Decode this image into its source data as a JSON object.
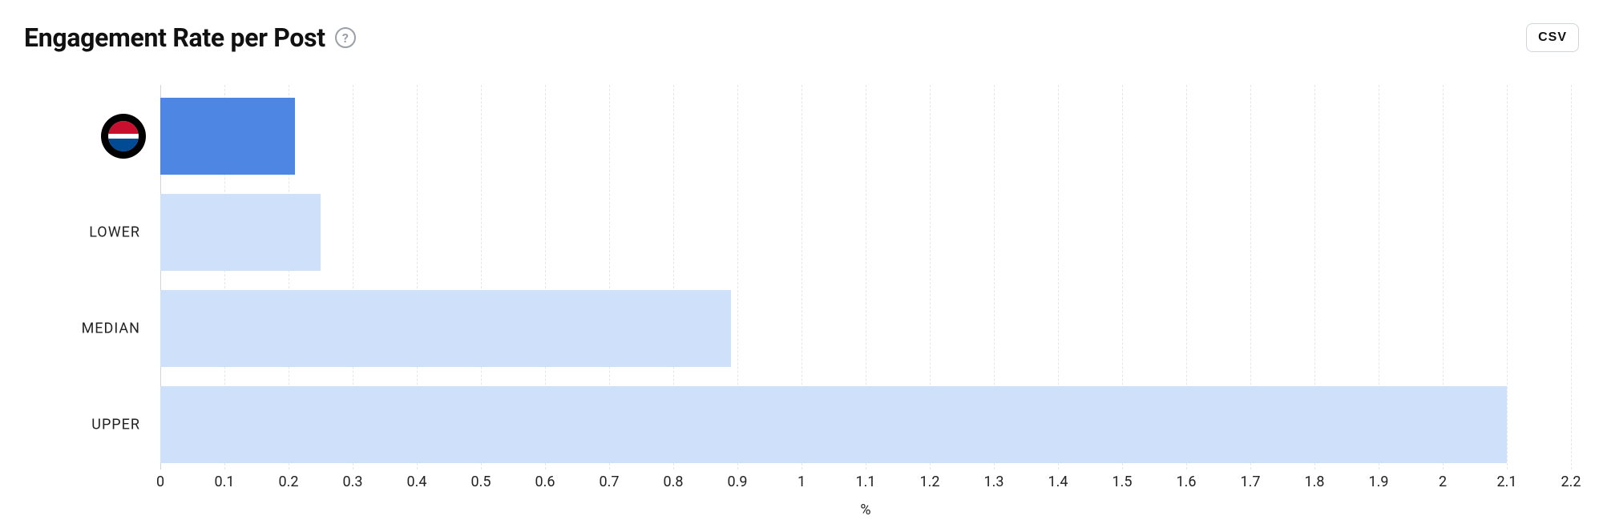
{
  "header": {
    "title": "Engagement Rate per Post",
    "help_tooltip": "?",
    "csv_button_label": "CSV"
  },
  "chart_data": {
    "type": "bar",
    "orientation": "horizontal",
    "categories": [
      "Brand (Pepsi)",
      "LOWER",
      "MEDIAN",
      "UPPER"
    ],
    "values": [
      0.21,
      0.25,
      0.89,
      2.1
    ],
    "colors": [
      "#4e86e4",
      "#cfe0fa",
      "#cfe0fa",
      "#cfe0fa"
    ],
    "xlabel": "%",
    "ylabel": "",
    "xlim": [
      0,
      2.2
    ],
    "x_ticks": [
      0,
      0.1,
      0.2,
      0.3,
      0.4,
      0.5,
      0.6,
      0.7,
      0.8,
      0.9,
      1,
      1.1,
      1.2,
      1.3,
      1.4,
      1.5,
      1.6,
      1.7,
      1.8,
      1.9,
      2,
      2.1,
      2.2
    ],
    "title": "Engagement Rate per Post",
    "grid": true
  },
  "y_axis_labels": {
    "brand_logo_alt": "Pepsi",
    "lower": "LOWER",
    "median": "MEDIAN",
    "upper": "UPPER"
  }
}
